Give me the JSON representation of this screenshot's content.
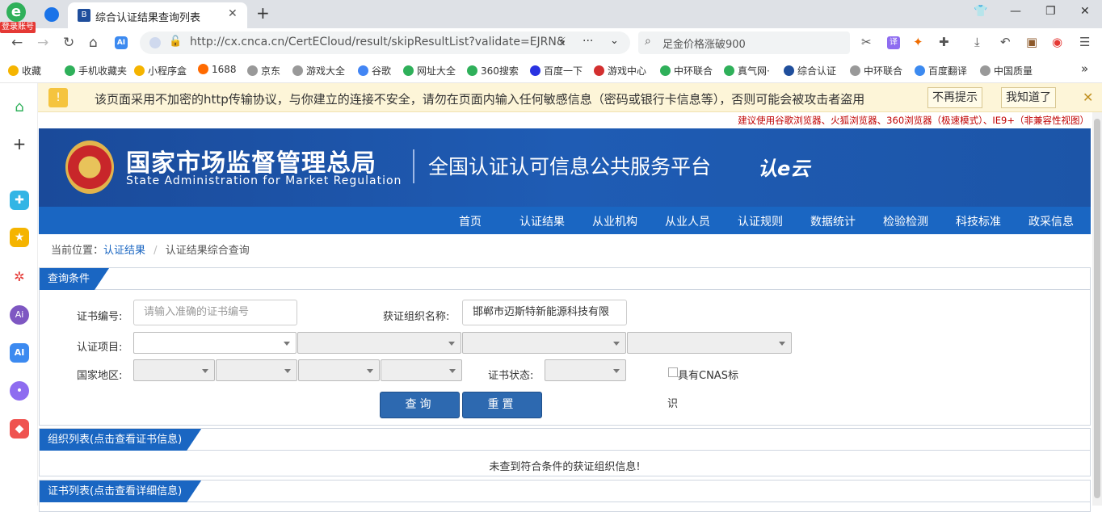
{
  "browser": {
    "login_badge": "登录账号",
    "tab_title": "综合认证结果查询列表",
    "url": "http://cx.cnca.cn/CertECloud/result/skipResultList?validate=EJRN&",
    "search_text": "足金价格涨破900",
    "ai_label": "AI",
    "tab_favicon": "B",
    "bookmarks": [
      {
        "label": "收藏",
        "color": "#f5b400"
      },
      {
        "label": "手机收藏夹",
        "color": "#2fb05a"
      },
      {
        "label": "小程序盒",
        "color": "#f5b400"
      },
      {
        "label": "1688",
        "color": "#ff6a00"
      },
      {
        "label": "京东",
        "color": "#999999"
      },
      {
        "label": "游戏大全",
        "color": "#999999"
      },
      {
        "label": "谷歌",
        "color": "#4285f4"
      },
      {
        "label": "网址大全",
        "color": "#2fb05a"
      },
      {
        "label": "360搜索",
        "color": "#2fb05a"
      },
      {
        "label": "百度一下",
        "color": "#2932e1"
      },
      {
        "label": "游戏中心",
        "color": "#d32f2f"
      },
      {
        "label": "中环联合",
        "color": "#2fb05a"
      },
      {
        "label": "真气网·",
        "color": "#2fb05a"
      },
      {
        "label": "综合认证",
        "color": "#1f4e9c"
      },
      {
        "label": "中环联合",
        "color": "#999999"
      },
      {
        "label": "百度翻译",
        "color": "#3c8af0"
      },
      {
        "label": "中国质量",
        "color": "#999999"
      }
    ],
    "more_bookmarks": "»",
    "warning_text": "该页面采用不加密的http传输协议，与你建立的连接不安全，请勿在页面内输入任何敏感信息（密码或银行卡信息等），否则可能会被攻击者盗用",
    "warning_btn_1": "不再提示",
    "warning_btn_2": "我知道了"
  },
  "sidebar_icons": [
    {
      "name": "home-icon",
      "color": "#ffffff"
    },
    {
      "name": "add-icon",
      "color": "#ffffff"
    },
    {
      "name": "mini-app-icon",
      "color": "#33b5e5"
    },
    {
      "name": "favorites-star-icon",
      "color": "#f5b400"
    },
    {
      "name": "network-icon",
      "color": "#e53935"
    },
    {
      "name": "ai-assistant-icon",
      "color": "#7e57c2"
    },
    {
      "name": "ai-icon",
      "color": "#3c8af0"
    },
    {
      "name": "chat-bot-icon",
      "color": "#8e6cf0"
    },
    {
      "name": "game-controller-icon",
      "color": "#ef5350"
    }
  ],
  "site": {
    "browser_hint": "建议使用谷歌浏览器、火狐浏览器、360浏览器（极速模式）、IE9+（非兼容性视图）",
    "name_cn": "国家市场监督管理总局",
    "name_en": "State Administration  for  Market Regulation",
    "platform": "全国认证认可信息公共服务平台",
    "logo_text": "认e云",
    "nav": [
      "首页",
      "认证结果",
      "从业机构",
      "从业人员",
      "认证规则",
      "数据统计",
      "检验检测",
      "科技标准",
      "政采信息"
    ],
    "breadcrumb_prefix": "当前位置：",
    "breadcrumb_link": "认证结果",
    "breadcrumb_sep": "/",
    "breadcrumb_current": "认证结果综合查询"
  },
  "query": {
    "title": "查询条件",
    "cert_no_label": "证书编号:",
    "cert_no_placeholder": "请输入准确的证书编号",
    "org_label": "获证组织名称:",
    "org_value": "邯郸市迈斯特新能源科技有限",
    "project_label": "认证项目:",
    "region_label": "国家地区:",
    "status_label": "证书状态:",
    "cnas_label": "具有CNAS标",
    "cnas_label_2": "识",
    "search_btn": "查询",
    "reset_btn": "重置"
  },
  "org_list": {
    "title": "组织列表(点击查看证书信息)",
    "empty": "未查到符合条件的获证组织信息!"
  },
  "cert_list": {
    "title": "证书列表(点击查看详细信息)"
  }
}
